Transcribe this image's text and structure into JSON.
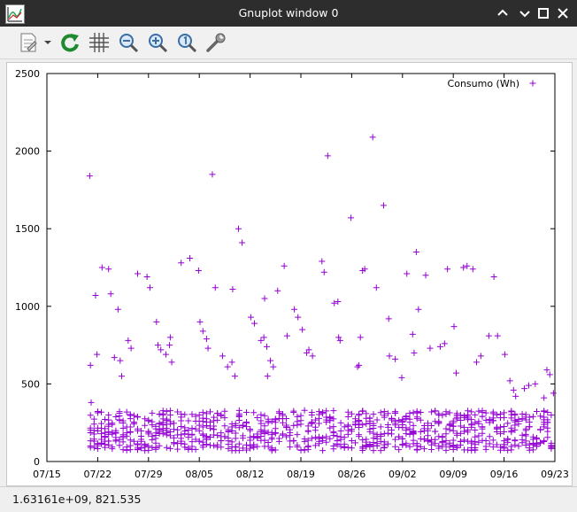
{
  "window": {
    "title": "Gnuplot window 0"
  },
  "toolbar": {
    "icons": [
      "copy-to-clipboard-icon",
      "replot-icon",
      "grid-icon",
      "zoom-out-icon",
      "zoom-in-icon",
      "zoom-original-icon",
      "settings-icon"
    ]
  },
  "status": {
    "text": "1.63161e+09,  821.535"
  },
  "colors": {
    "series": "#9400d3",
    "titlebar": "#2d2d2d"
  },
  "chart_data": {
    "type": "scatter",
    "title": "",
    "xlabel": "",
    "ylabel": "",
    "xlim": [
      0,
      70
    ],
    "ylim": [
      0,
      2500
    ],
    "x_tick_labels": [
      "07/15",
      "07/22",
      "07/29",
      "08/05",
      "08/12",
      "08/19",
      "08/26",
      "09/02",
      "09/09",
      "09/16",
      "09/23"
    ],
    "x_tick_positions": [
      0,
      7,
      14,
      21,
      28,
      35,
      42,
      49,
      56,
      63,
      70
    ],
    "y_ticks": [
      0,
      500,
      1000,
      1500,
      2000,
      2500
    ],
    "grid": false,
    "legend_position": "top-right",
    "series": [
      {
        "name": "Consumo (Wh)",
        "marker": "+",
        "x": [
          5.9,
          6.0,
          6.1,
          6.7,
          6.9,
          7.6,
          8.5,
          8.8,
          9.3,
          9.8,
          10.1,
          10.3,
          11.2,
          11.6,
          12.5,
          13.8,
          14.2,
          15.1,
          15.3,
          15.7,
          16.4,
          16.9,
          17.0,
          17.2,
          18.5,
          19.7,
          20.9,
          21.1,
          21.5,
          22.0,
          22.2,
          22.8,
          23.2,
          24.2,
          24.9,
          25.5,
          25.6,
          25.9,
          26.4,
          26.9,
          28.1,
          28.6,
          29.5,
          29.9,
          30.0,
          30.3,
          30.4,
          30.8,
          31.2,
          31.8,
          32.7,
          33.1,
          34.1,
          34.6,
          35.2,
          35.8,
          36.1,
          36.6,
          37.9,
          38.2,
          38.7,
          39.6,
          40.1,
          40.2,
          40.4,
          41.9,
          42.8,
          43.0,
          43.2,
          43.5,
          43.8,
          44.9,
          45.4,
          46.4,
          47.1,
          47.2,
          48.0,
          48.9,
          49.6,
          50.4,
          50.6,
          50.9,
          51.2,
          52.2,
          52.8,
          54.2,
          54.8,
          55.2,
          56.1,
          56.4,
          57.4,
          57.9,
          58.7,
          59.2,
          59.8,
          60.9,
          61.6,
          62.1,
          63.1,
          63.8,
          64.3,
          64.6,
          65.8,
          66.4,
          67.3,
          68.5,
          68.9,
          69.3,
          69.8
        ],
        "values": [
          1840,
          620,
          380,
          1070,
          690,
          1250,
          1240,
          1080,
          670,
          980,
          650,
          550,
          780,
          730,
          1210,
          1190,
          1120,
          900,
          750,
          720,
          690,
          750,
          800,
          640,
          1280,
          1310,
          1230,
          900,
          840,
          790,
          730,
          1850,
          1120,
          680,
          610,
          640,
          1110,
          550,
          1500,
          1410,
          930,
          890,
          780,
          800,
          1050,
          740,
          550,
          650,
          610,
          1100,
          1260,
          810,
          980,
          930,
          850,
          700,
          720,
          680,
          1290,
          1220,
          1970,
          1020,
          1030,
          800,
          780,
          1570,
          610,
          620,
          800,
          1230,
          1240,
          2090,
          1120,
          1650,
          920,
          680,
          660,
          540,
          1210,
          820,
          700,
          1350,
          980,
          1200,
          730,
          740,
          760,
          1240,
          870,
          570,
          1250,
          1260,
          1240,
          640,
          680,
          810,
          1190,
          810,
          690,
          520,
          460,
          420,
          470,
          490,
          500,
          410,
          590,
          560,
          440
        ]
      }
    ]
  }
}
